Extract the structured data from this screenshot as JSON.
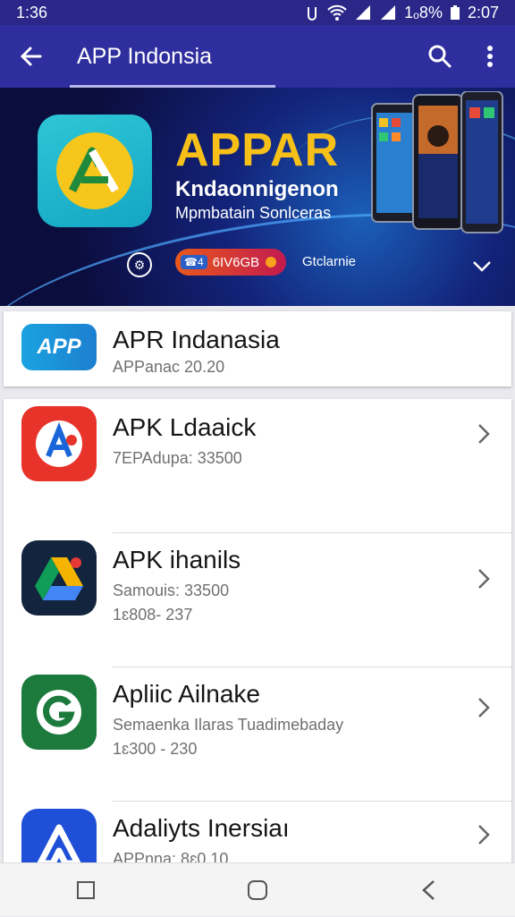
{
  "status_bar": {
    "time_left": "1:36",
    "battery_text": "1ₒ8%",
    "time_right": "2:07"
  },
  "app_bar": {
    "title": "APP Indonsia",
    "back_icon": "arrow-left-icon",
    "search_icon": "search-icon",
    "more_icon": "more-vert-icon"
  },
  "banner": {
    "headline": "APPAR",
    "subtitle": "Kndaonnigenon",
    "tagline": "Mpmbatain Sonlceras",
    "pill_chip": "☎4",
    "pill_label": "6IV6GB",
    "pill_tail": "Gtclarnie",
    "colors": {
      "headline": "#f6c019",
      "pill": "#e8581c"
    }
  },
  "featured": {
    "name": "APR Indanasia",
    "meta": "APPanac 20.20",
    "icon_text": "APP"
  },
  "apps": [
    {
      "name": "APK Ldaaick",
      "meta": "7EPAdupa: 33500",
      "meta2": "",
      "icon": "red-a-icon",
      "color": "#e8332a"
    },
    {
      "name": "APK ihanils",
      "meta": "Samouis: 33500",
      "meta2": "1ɛ808- 237",
      "icon": "drive-icon",
      "color": "#12243e"
    },
    {
      "name": "Apliic Ailnake",
      "meta": "Semaenka Ilaras Tuadimebaday",
      "meta2": "1ɛ300 - 230",
      "icon": "green-g-icon",
      "color": "#1b7a3c"
    },
    {
      "name": "Adaliyts Inersiaı",
      "meta": "APPnna: 8ɛ0.10",
      "meta2": "",
      "icon": "blue-a-icon",
      "color": "#1e4fd6"
    }
  ]
}
